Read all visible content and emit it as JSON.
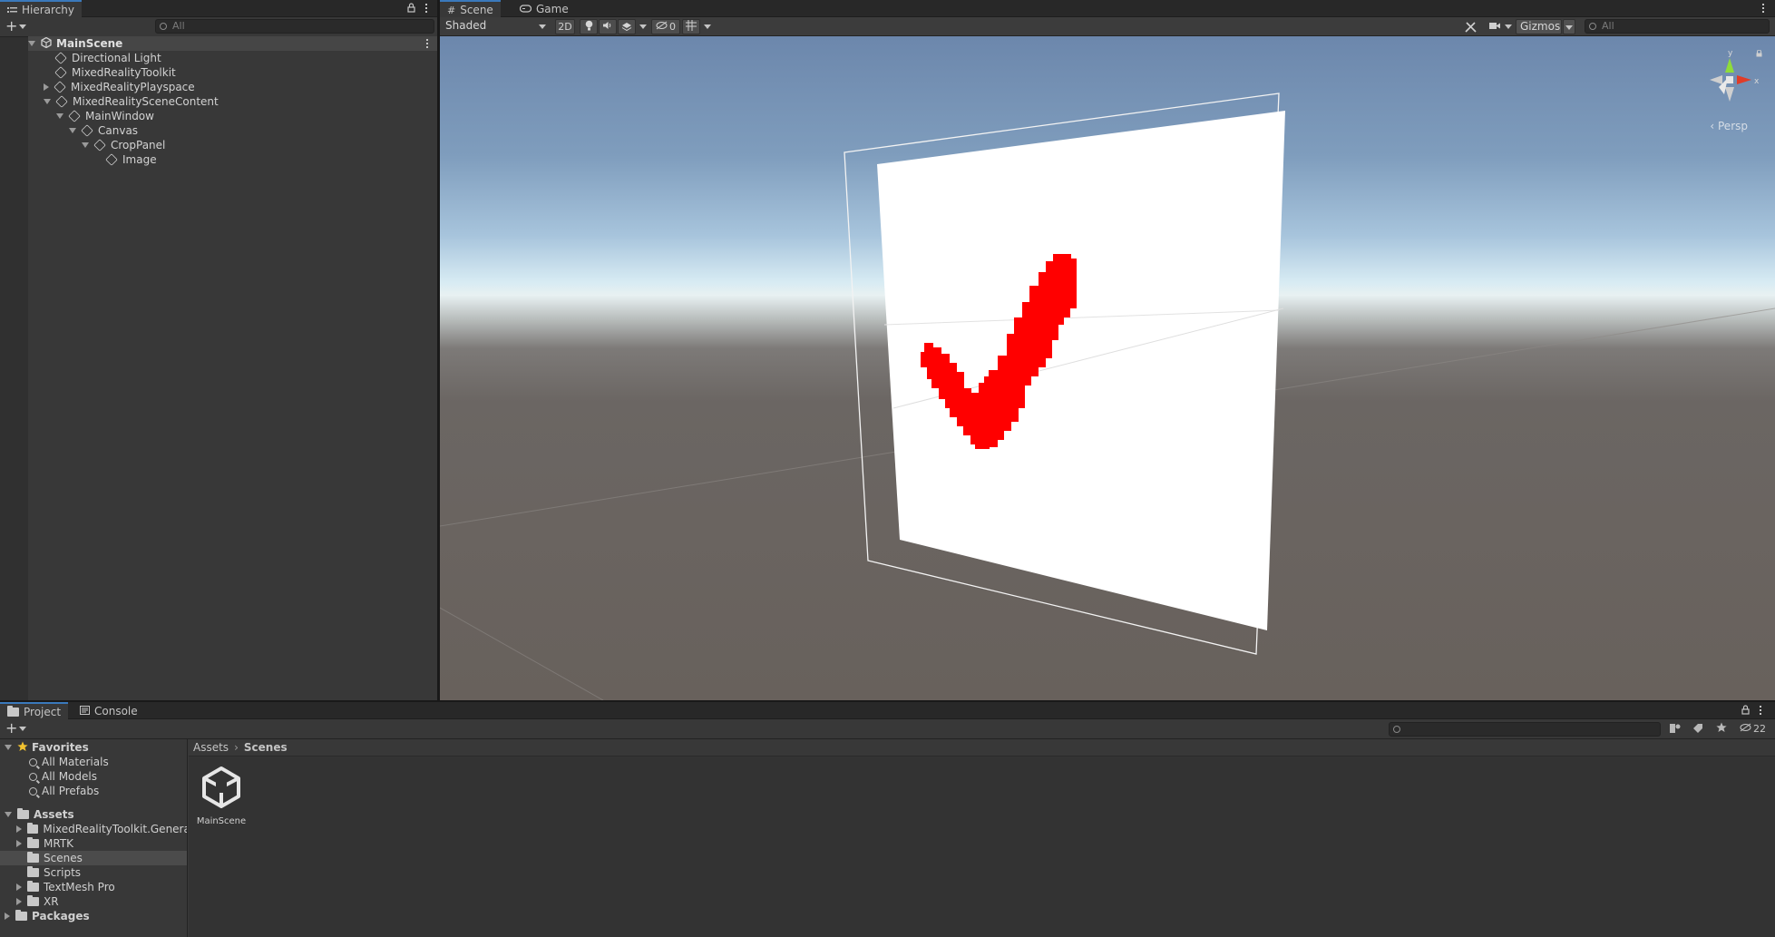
{
  "hierarchy": {
    "tab_label": "Hierarchy",
    "search_placeholder": "All",
    "scene_name": "MainScene",
    "items": [
      {
        "label": "Directional Light"
      },
      {
        "label": "MixedRealityToolkit"
      },
      {
        "label": "MixedRealityPlayspace"
      },
      {
        "label": "MixedRealitySceneContent"
      },
      {
        "label": "MainWindow"
      },
      {
        "label": "Canvas"
      },
      {
        "label": "CropPanel"
      },
      {
        "label": "Image"
      }
    ]
  },
  "scene_view": {
    "tabs": [
      {
        "label": "Scene"
      },
      {
        "label": "Game"
      }
    ],
    "shading_mode": "Shaded",
    "mode_2d_label": "2D",
    "hidden_count": "0",
    "gizmos_label": "Gizmos",
    "search_placeholder": "All",
    "axes": {
      "x": "x",
      "y": "y"
    },
    "projection_label": "Persp",
    "checkmark_color": "#ff0000"
  },
  "project": {
    "tabs": [
      {
        "label": "Project"
      },
      {
        "label": "Console"
      }
    ],
    "hidden_count": "22",
    "favorites": {
      "label": "Favorites",
      "items": [
        {
          "label": "All Materials"
        },
        {
          "label": "All Models"
        },
        {
          "label": "All Prefabs"
        }
      ]
    },
    "assets": {
      "label": "Assets",
      "folders": [
        {
          "label": "MixedRealityToolkit.Generat"
        },
        {
          "label": "MRTK"
        },
        {
          "label": "Scenes"
        },
        {
          "label": "Scripts"
        },
        {
          "label": "TextMesh Pro"
        },
        {
          "label": "XR"
        }
      ]
    },
    "packages_label": "Packages",
    "breadcrumb": {
      "root": "Assets",
      "current": "Scenes"
    },
    "files": [
      {
        "label": "MainScene",
        "icon": "unity-scene-icon"
      }
    ]
  }
}
